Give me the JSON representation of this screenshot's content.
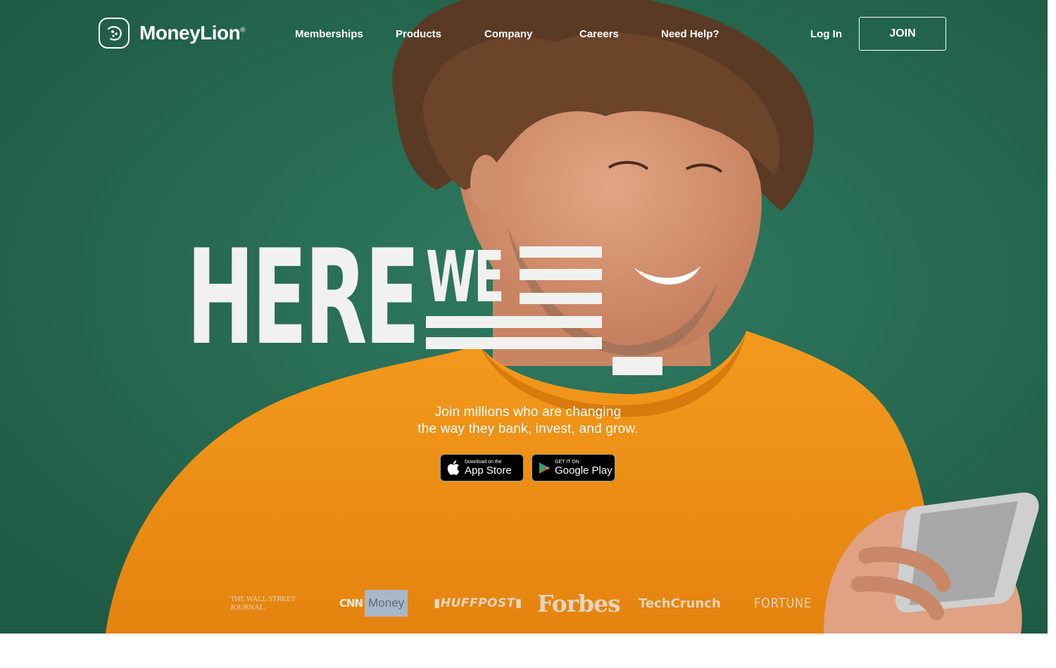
{
  "brand": {
    "name": "MoneyLion",
    "registered": "®"
  },
  "nav": {
    "items": [
      {
        "label": "Memberships"
      },
      {
        "label": "Products"
      },
      {
        "label": "Company"
      },
      {
        "label": "Careers"
      },
      {
        "label": "Need Help?"
      }
    ],
    "login_label": "Log In",
    "join_label": "JOIN"
  },
  "hero": {
    "headline_here": "HERE",
    "headline_we": "WE",
    "tagline_line1": "Join millions who are changing",
    "tagline_line2": "the way they bank, invest, and grow."
  },
  "app_buttons": {
    "apple": {
      "small": "Download on the",
      "big": "App Store",
      "icon": "apple-icon"
    },
    "google": {
      "small": "GET IT ON",
      "big": "Google Play",
      "icon": "google-play-icon"
    }
  },
  "press_logos": [
    {
      "label": "THE WALL STREET JOURNAL."
    },
    {
      "label_cnn": "CNN",
      "label_money": "Money"
    },
    {
      "label": "HUFFPOST"
    },
    {
      "label": "Forbes"
    },
    {
      "label": "TechCrunch"
    },
    {
      "label": "FORTUNE"
    }
  ],
  "colors": {
    "background_green": "#27694f",
    "sweater_orange": "#f0921a",
    "headline_white": "#f1f1f0"
  }
}
